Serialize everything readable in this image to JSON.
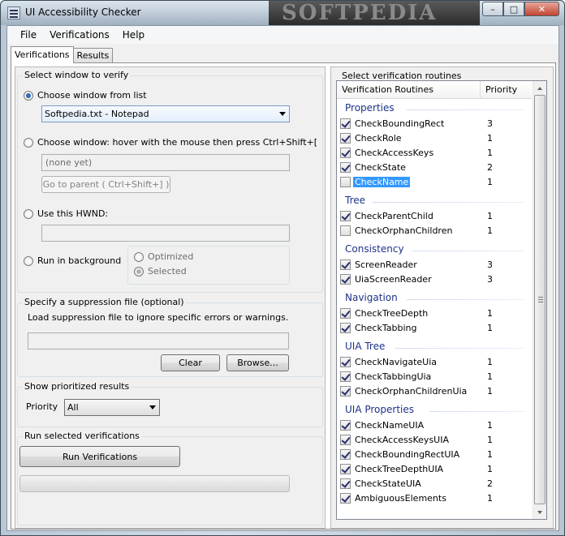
{
  "window": {
    "title": "UI Accessibility Checker",
    "watermark": "SOFTPEDIA",
    "minimize": "–",
    "maximize": "□",
    "close": "✕"
  },
  "menu": {
    "file": "File",
    "verifications": "Verifications",
    "help": "Help"
  },
  "tabs": {
    "verifications": "Verifications",
    "results": "Results"
  },
  "select_window": {
    "title": "Select window to verify",
    "choose_from_list": "Choose window from list",
    "selected_window": "Softpedia.txt - Notepad",
    "hover_option": "Choose window: hover with the mouse then press Ctrl+Shift+[",
    "hover_value": "(none yet)",
    "go_to_parent": "Go to parent ( Ctrl+Shift+] )",
    "use_hwnd": "Use this HWND:",
    "run_background": "Run in background",
    "optimized": "Optimized",
    "selected": "Selected"
  },
  "suppression": {
    "title": "Specify a suppression file (optional)",
    "description": "Load suppression file to ignore specific errors or warnings.",
    "clear": "Clear",
    "browse": "Browse..."
  },
  "prioritized": {
    "title": "Show prioritized results",
    "priority_label": "Priority",
    "priority_value": "All"
  },
  "run": {
    "title": "Run selected verifications",
    "button": "Run Verifications",
    "progress": 0
  },
  "routines": {
    "title": "Select verification routines",
    "col_routines": "Verification Routines",
    "col_priority": "Priority",
    "groups": [
      {
        "name": "Properties",
        "items": [
          {
            "name": "CheckBoundingRect",
            "priority": "3",
            "checked": true
          },
          {
            "name": "CheckRole",
            "priority": "1",
            "checked": true
          },
          {
            "name": "CheckAccessKeys",
            "priority": "1",
            "checked": true
          },
          {
            "name": "CheckState",
            "priority": "2",
            "checked": true
          },
          {
            "name": "CheckName",
            "priority": "1",
            "checked": false,
            "selected": true
          }
        ]
      },
      {
        "name": "Tree",
        "items": [
          {
            "name": "CheckParentChild",
            "priority": "1",
            "checked": true
          },
          {
            "name": "CheckOrphanChildren",
            "priority": "1",
            "checked": false
          }
        ]
      },
      {
        "name": "Consistency",
        "items": [
          {
            "name": "ScreenReader",
            "priority": "3",
            "checked": true
          },
          {
            "name": "UiaScreenReader",
            "priority": "3",
            "checked": true
          }
        ]
      },
      {
        "name": "Navigation",
        "items": [
          {
            "name": "CheckTreeDepth",
            "priority": "1",
            "checked": true
          },
          {
            "name": "CheckTabbing",
            "priority": "1",
            "checked": true
          }
        ]
      },
      {
        "name": "UIA Tree",
        "items": [
          {
            "name": "CheckNavigateUia",
            "priority": "1",
            "checked": true
          },
          {
            "name": "CheckTabbingUia",
            "priority": "1",
            "checked": true
          },
          {
            "name": "CheckOrphanChildrenUia",
            "priority": "1",
            "checked": true
          }
        ]
      },
      {
        "name": "UIA Properties",
        "items": [
          {
            "name": "CheckNameUIA",
            "priority": "1",
            "checked": true
          },
          {
            "name": "CheckAccessKeysUIA",
            "priority": "1",
            "checked": true
          },
          {
            "name": "CheckBoundingRectUIA",
            "priority": "1",
            "checked": true
          },
          {
            "name": "CheckTreeDepthUIA",
            "priority": "1",
            "checked": true
          },
          {
            "name": "CheckStateUIA",
            "priority": "2",
            "checked": true
          },
          {
            "name": "AmbiguousElements",
            "priority": "1",
            "checked": true
          }
        ]
      }
    ]
  }
}
